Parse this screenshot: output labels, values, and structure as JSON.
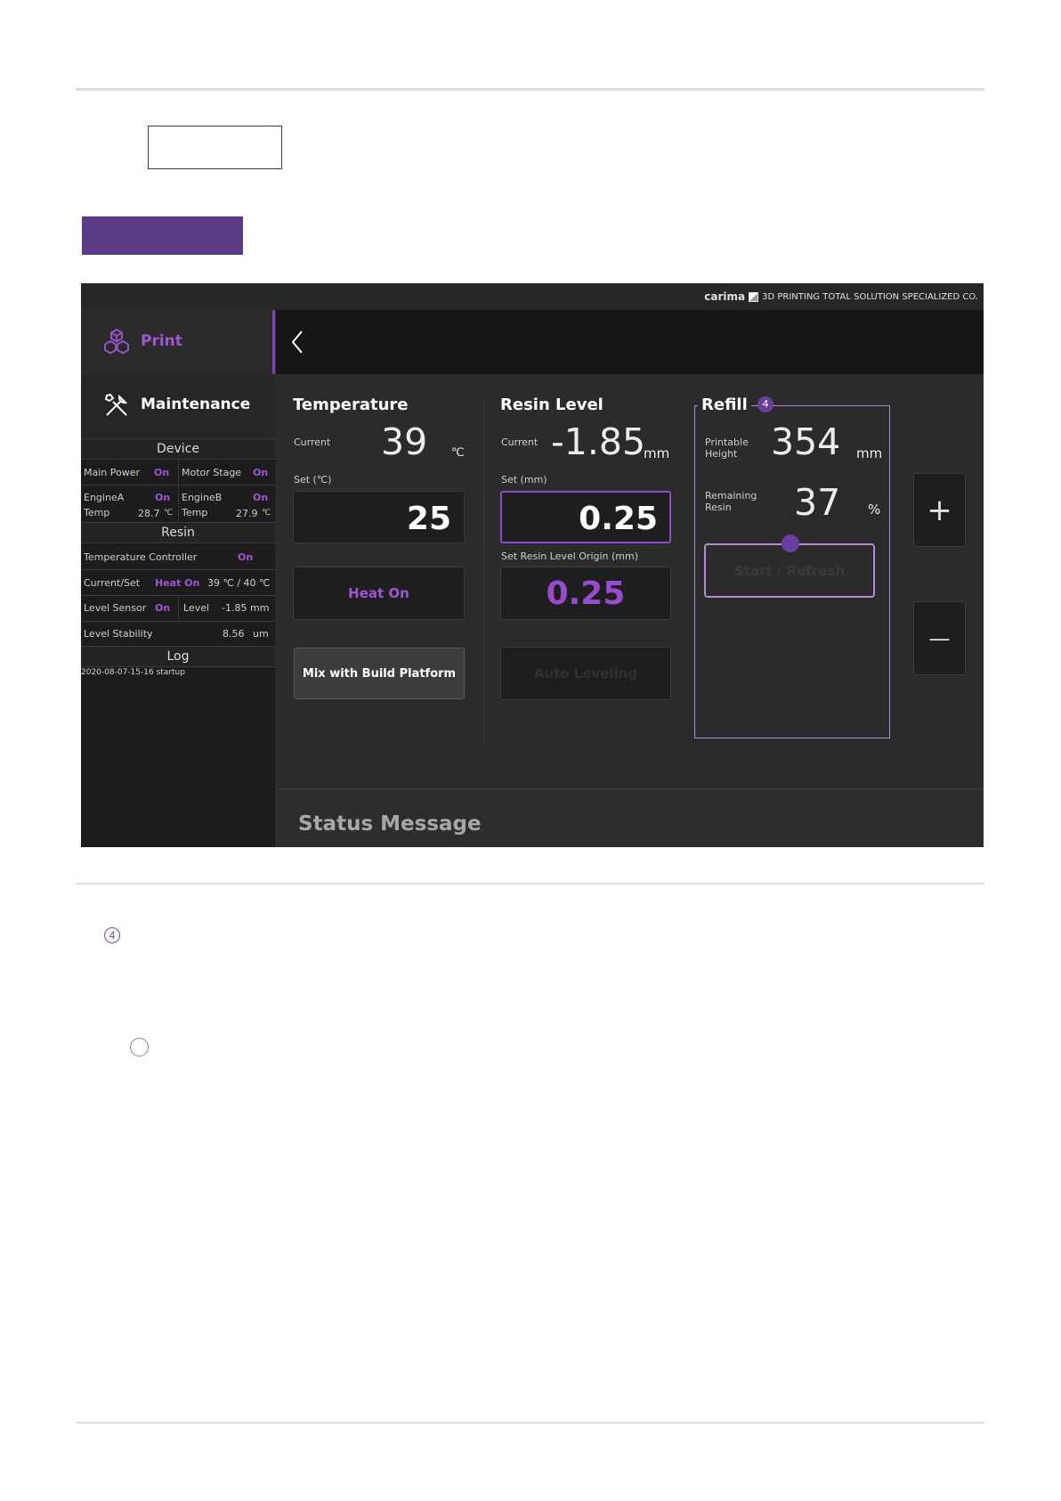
{
  "brand": {
    "logo": "carima",
    "tagline": "3D PRINTING TOTAL SOLUTION SPECIALIZED CO."
  },
  "nav": {
    "print": "Print",
    "maintenance": "Maintenance"
  },
  "device": {
    "title": "Device",
    "main_power_label": "Main Power",
    "main_power_value": "On",
    "motor_stage_label": "Motor Stage",
    "motor_stage_value": "On",
    "engine_a_label": "EngineA",
    "engine_a_value": "On",
    "engine_a_temp_label": "Temp",
    "engine_a_temp": "28.7",
    "engine_a_unit": "℃",
    "engine_b_label": "EngineB",
    "engine_b_value": "On",
    "engine_b_temp_label": "Temp",
    "engine_b_temp": "27.9",
    "engine_b_unit": "℃"
  },
  "resin_panel": {
    "title": "Resin",
    "temp_controller_label": "Temperature Controller",
    "temp_controller_value": "On",
    "current_set_label": "Current/Set",
    "current_set_heat": "Heat On",
    "current_set_value": "39 ℃ / 40 ℃",
    "level_sensor_label": "Level Sensor",
    "level_sensor_value": "On",
    "level_label": "Level",
    "level_value": "-1.85",
    "level_unit": "mm",
    "stability_label": "Level Stability",
    "stability_value": "8.56",
    "stability_unit": "um"
  },
  "log": {
    "title": "Log",
    "entries": [
      "2020-08-07-15-16 startup"
    ]
  },
  "temperature": {
    "title": "Temperature",
    "current_label": "Current",
    "current_value": "39",
    "current_unit": "℃",
    "set_label": "Set (℃)",
    "set_value": "25",
    "heat_button": "Heat On",
    "mix_button": "Mix with Build Platform"
  },
  "resin_level": {
    "title": "Resin Level",
    "current_label": "Current",
    "current_value": "-1.85",
    "current_unit": "mm",
    "set_label": "Set (mm)",
    "set_value": "0.25",
    "origin_label": "Set Resin Level Origin (mm)",
    "origin_value": "0.25",
    "auto_button": "Auto Leveling"
  },
  "refill": {
    "title": "Refill",
    "badge": "4",
    "height_label_1": "Printable",
    "height_label_2": "Height",
    "height_value": "354",
    "height_unit": "mm",
    "resin_label_1": "Remaining",
    "resin_label_2": "Resin",
    "resin_value": "37",
    "resin_unit": "%",
    "start_button": "Start / Refresh"
  },
  "controls": {
    "plus": "+",
    "minus": "—"
  },
  "status": {
    "label": "Status Message"
  },
  "footnote": {
    "marker": "4"
  },
  "colors": {
    "accent": "#a154d6",
    "header_bar": "#5b3a86",
    "panel": "#2b2b2b",
    "sidebar": "#1c1c1c"
  }
}
